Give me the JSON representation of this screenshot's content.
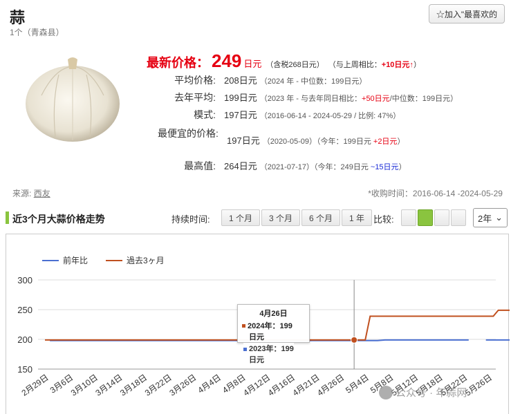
{
  "header": {
    "title": "蒜",
    "subtitle": "1个（青森县）",
    "fav_label": "☆加入\"最喜欢的"
  },
  "latest": {
    "label": "最新价格：",
    "price": "249",
    "unit": "日元",
    "tax": "（含税268日元）",
    "cmp_prefix": "（与上周相比：",
    "cmp_value": "+10日元↑",
    "cmp_suffix": "）"
  },
  "stats": {
    "avg": {
      "label": "平均价格:",
      "value": "208日元",
      "note": "（2024 年 - 中位数：199日元）"
    },
    "last_year": {
      "label": "去年平均:",
      "value": "199日元",
      "note_pre": "（2023 年 - 与去年同日相比：",
      "note_red": "+50日元",
      "note_post": "/中位数：199日元）"
    },
    "mode": {
      "label": "模式:",
      "value": "197日元",
      "note": "（2016-06-14 - 2024-05-29 / 比例: 47%）"
    },
    "cheapest": {
      "label": "最便宜的价格:",
      "value": "197日元",
      "note_pre": "（2020-05-09）（今年：199日元",
      "note_red": "+2日元",
      "note_post": "）"
    },
    "highest": {
      "label": "最高值:",
      "value": "264日元",
      "note_pre": "（2021-07-17）（今年：249日元",
      "note_blue": "~15日元",
      "note_post": "）"
    }
  },
  "source": {
    "label": "来源:",
    "link": "西友"
  },
  "collect": "*收购时间：2016-06-14 -2024-05-29",
  "section": {
    "title": "近3个月大蒜价格走势",
    "duration_label": "持续时间:",
    "durations": [
      "1 个月",
      "3 个月",
      "6 个月",
      "1 年"
    ],
    "compare_label": "比较:",
    "year_select": "2年"
  },
  "tooltip": {
    "date": "4月26日",
    "row1": "2024年：199",
    "row1b": "日元",
    "row2": "2023年：199",
    "row2b": "日元"
  },
  "watermark": "公众号 · 年蒜网",
  "colors": {
    "blue_series": "#4a6fd1",
    "red_series": "#c0501f",
    "accent_green": "#8ac43f",
    "price_red": "#e60012"
  },
  "chart_data": {
    "type": "line",
    "legend": [
      "前年比",
      "過去3ヶ月"
    ],
    "legend_position": "top-left",
    "ylim": [
      150,
      300
    ],
    "yticks": [
      300,
      250,
      200,
      150
    ],
    "xticks": [
      "2月29日",
      "3月6日",
      "3月10日",
      "3月14日",
      "3月18日",
      "3月22日",
      "3月26日",
      "4月4日",
      "4月8日",
      "4月12日",
      "4月16日",
      "4月21日",
      "4月26日",
      "5月4日",
      "5月8日",
      "5月12日",
      "5月18日",
      "5月22日",
      "5月26日"
    ],
    "grid": true,
    "series": [
      {
        "name": "前年比",
        "color": "#4a6fd1",
        "points": [
          [
            0.2,
            198
          ],
          [
            13.5,
            198
          ],
          [
            13.8,
            199
          ],
          [
            17.2,
            199
          ],
          [
            17.5,
            null
          ],
          [
            17.9,
            199
          ],
          [
            19.2,
            199
          ]
        ]
      },
      {
        "name": "過去3ヶ月",
        "color": "#c0501f",
        "points": [
          [
            0,
            199
          ],
          [
            13.0,
            199
          ],
          [
            13.0,
            199
          ],
          [
            13.2,
            239
          ],
          [
            18.2,
            239
          ],
          [
            18.4,
            249
          ],
          [
            19.2,
            249
          ]
        ]
      }
    ]
  }
}
